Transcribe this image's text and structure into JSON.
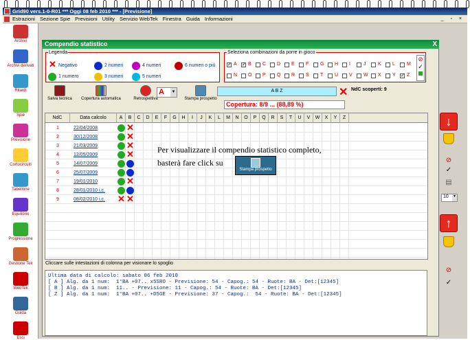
{
  "window": {
    "title": "Grid90 vers.1-0-R01  ***  Oggi 08 feb 2010  ***  - [Previsione]"
  },
  "menu": [
    "Estrazioni",
    "Sezione Spie",
    "Previsioni",
    "Utility",
    "Servizio WebTek",
    "Finestra",
    "Guida",
    "Informazioni"
  ],
  "sidebar": [
    "Archivi",
    "Archivi derivati",
    "Ritardi",
    "Spie",
    "Previsione",
    "Cortocircuiti",
    "Tabellone",
    "Equilibrio",
    "Progressione",
    "Gestione Tek",
    "WebTek",
    "Guida",
    "Esci"
  ],
  "dialog": {
    "title": "Compendio statistico",
    "legend_title": "Legenda",
    "legend": [
      {
        "label": "Negativo",
        "color": "#e00000",
        "icon": "x"
      },
      {
        "label": "2 numeri",
        "color": "#0a2acc"
      },
      {
        "label": "4 numeri",
        "color": "#c000c0"
      },
      {
        "label": "6 numeri o più",
        "color": "#c00000"
      },
      {
        "label": "1 numero",
        "color": "#22aa22"
      },
      {
        "label": "3 numeri",
        "color": "#f0c000"
      },
      {
        "label": "5 numeri",
        "color": "#00b8e0"
      }
    ],
    "combo_title": "Seleziona combinazioni da porre in gioco",
    "combos_row1": [
      "A",
      "B",
      "C",
      "D",
      "E",
      "F",
      "G",
      "H",
      "I",
      "J",
      "K",
      "L",
      "M"
    ],
    "combos_row2": [
      "N",
      "O",
      "P",
      "Q",
      "R",
      "S",
      "T",
      "U",
      "V",
      "W",
      "X",
      "Y",
      "Z"
    ],
    "checked": [
      "A",
      "B",
      "Z"
    ],
    "toolbar": {
      "save": "Salva tecnica",
      "auto": "Copertura automatica",
      "retro": "Retrospettiva",
      "retro_value": "A",
      "print": "Stampa prospetto"
    },
    "selected_combos": "A B Z",
    "ndc_scoperti": "NdC scoperti: 9",
    "coverage": "Copertura: 8/9 ... (88,89 %)",
    "grid_headers": {
      "ndc": "NdC",
      "date": "Data calcolo"
    },
    "columns": [
      "A",
      "B",
      "C",
      "D",
      "E",
      "F",
      "G",
      "H",
      "I",
      "J",
      "K",
      "L",
      "M",
      "N",
      "O",
      "P",
      "Q",
      "R",
      "S",
      "T",
      "U",
      "V",
      "W",
      "X",
      "Y",
      "Z"
    ],
    "rows": [
      {
        "n": "1",
        "date": "22/04/2008",
        "A": "green",
        "B": "x"
      },
      {
        "n": "2",
        "date": "30/12/2008",
        "A": "green",
        "B": "x"
      },
      {
        "n": "3",
        "date": "21/03/2009",
        "A": "green",
        "B": "x"
      },
      {
        "n": "4",
        "date": "12/05/2009",
        "A": "green",
        "B": "x"
      },
      {
        "n": "5",
        "date": "14/07/2009",
        "A": "green",
        "B": "blue"
      },
      {
        "n": "6",
        "date": "25/07/2009",
        "A": "green",
        "B": "blue"
      },
      {
        "n": "7",
        "date": "19/01/2010",
        "A": "green",
        "B": "x"
      },
      {
        "n": "8",
        "date": "28/01/2010 i.c.",
        "A": "green",
        "B": "blue"
      },
      {
        "n": "9",
        "date": "08/02/2010 i.c.",
        "A": "x",
        "B": "x"
      }
    ],
    "message_line1": "Per visualizzare il compendio statistico completo,",
    "message_line2": "basterà fare click su",
    "message_button": "Stampa prospetto",
    "hint": "Cliccare sulle intestazioni di colonna per visionare lo spoglio",
    "output": [
      "Ultima data di calcolo: sabato 06 feb 2010",
      "",
      "[ A ] Alg. da 1 num:  1°BA +07.. x5SRO - Previsione: 54 - Capog.: 54 - Ruote: BA - Det:[12345]",
      "[ B ] Alg. da 1 num:  11.. - Previsione: 11 - Capog.: 54 - Ruote: BA - Det:[12345]",
      "[ Z ] Alg. da 1 num:  1°BA +07.. +D5GE - Previsione: 37 - Capog.:  54 - Ruote: BA - Det:[12345]"
    ],
    "page_select": "10"
  }
}
